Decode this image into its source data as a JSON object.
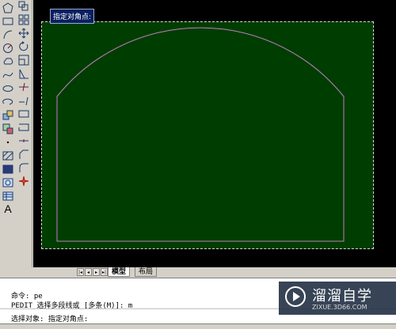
{
  "draw_toolbar": {
    "icons": [
      "polygon-icon",
      "rectangle-icon",
      "arc-icon",
      "circle-icon",
      "revision-cloud-icon",
      "spline-icon",
      "ellipse-icon",
      "ellipse-arc-icon",
      "insert-block-icon",
      "make-block-icon",
      "point-icon",
      "hatch-icon",
      "gradient-icon",
      "region-icon",
      "table-icon",
      "multiline-text-icon"
    ],
    "text_button": "A"
  },
  "modify_toolbar": {
    "icons": [
      "copy-icon",
      "array-icon",
      "move-icon",
      "rotate-icon",
      "scale-icon",
      "stretch-icon",
      "trim-icon",
      "extend-icon",
      "break-at-point-icon",
      "break-icon",
      "join-icon",
      "chamfer-icon",
      "fillet-icon",
      "explode-icon"
    ]
  },
  "drawing": {
    "background": "#000000",
    "paper_color": "#003d00",
    "line_color": "#c080c0",
    "tooltip": "指定对角点:"
  },
  "tabs": {
    "model": "模型",
    "layout": "布局"
  },
  "command": {
    "line1": "命令: pe",
    "line2": "PEDIT 选择多段线或 [多条(M)]: m",
    "line3": "选择对象: 指定对角点:"
  },
  "watermark": {
    "title": "溜溜自学",
    "subtitle": "ZIXUE.3D66.COM"
  }
}
